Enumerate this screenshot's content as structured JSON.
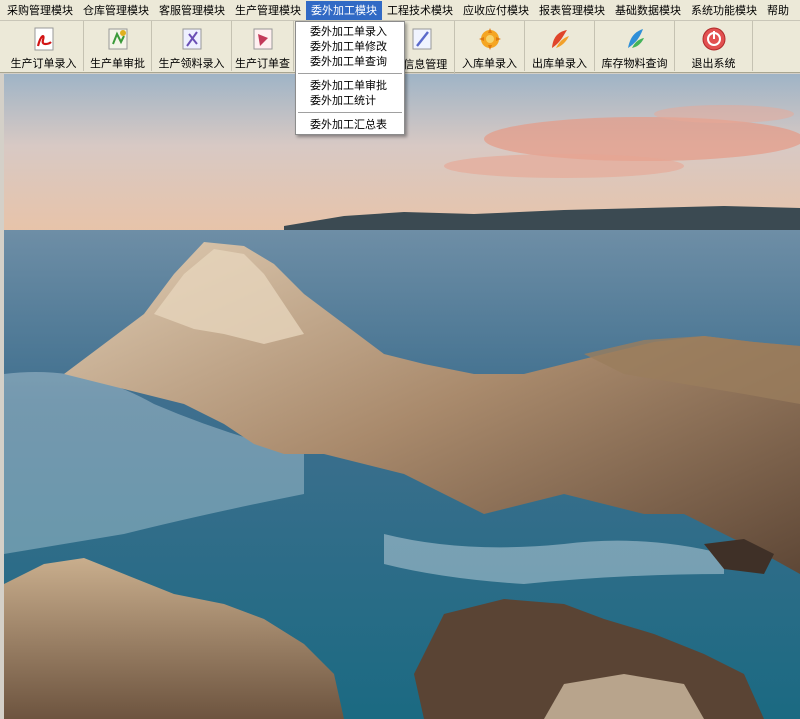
{
  "menubar": {
    "items": [
      {
        "label": "采购管理模块"
      },
      {
        "label": "仓库管理模块"
      },
      {
        "label": "客服管理模块"
      },
      {
        "label": "生产管理模块"
      },
      {
        "label": "委外加工模块"
      },
      {
        "label": "工程技术模块"
      },
      {
        "label": "应收应付模块"
      },
      {
        "label": "报表管理模块"
      },
      {
        "label": "基础数据模块"
      },
      {
        "label": "系统功能模块"
      },
      {
        "label": "帮助"
      }
    ],
    "active_index": 4
  },
  "toolbar": {
    "buttons": [
      {
        "label": "生产订单录入",
        "icon": "pdf-document-icon"
      },
      {
        "label": "生产单审批",
        "icon": "approval-sheet-icon"
      },
      {
        "label": "生产领料录入",
        "icon": "material-requisition-icon"
      },
      {
        "label": "生产订单查",
        "icon": "order-query-icon"
      },
      {
        "label": "P信息管理",
        "icon": "info-management-icon"
      },
      {
        "label": "入库单录入",
        "icon": "warehouse-in-icon"
      },
      {
        "label": "出库单录入",
        "icon": "warehouse-out-icon"
      },
      {
        "label": "库存物料查询",
        "icon": "inventory-query-icon"
      },
      {
        "label": "退出系统",
        "icon": "power-icon"
      }
    ]
  },
  "dropdown": {
    "groups": [
      [
        "委外加工单录入",
        "委外加工单修改",
        "委外加工单查询"
      ],
      [
        "委外加工单审批",
        "委外加工统计"
      ],
      [
        "委外加工汇总表"
      ]
    ]
  },
  "colors": {
    "menu_bg": "#ece9d8",
    "highlight": "#316ac5",
    "sea": "#1f6f8f",
    "rock": "#a98a6c"
  }
}
